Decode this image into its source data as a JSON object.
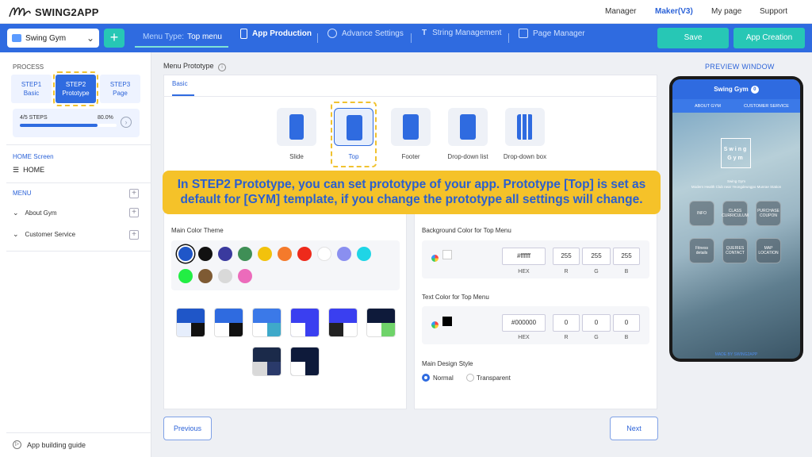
{
  "brand": {
    "name": "SWING2APP"
  },
  "topnav": [
    {
      "label": "Manager",
      "active": false
    },
    {
      "label": "Maker(V3)",
      "active": true
    },
    {
      "label": "My page",
      "active": false
    },
    {
      "label": "Support",
      "active": false
    }
  ],
  "toolbar": {
    "app_name": "Swing Gym",
    "menu_type_label": "Menu Type:",
    "menu_type_value": "Top menu",
    "items": [
      "App Production",
      "Advance Settings",
      "String Management",
      "Page Manager"
    ],
    "save_label": "Save",
    "create_label": "App Creation"
  },
  "sidebar": {
    "process_title": "PROCESS",
    "steps": [
      {
        "line1": "STEP1",
        "line2": "Basic"
      },
      {
        "line1": "STEP2",
        "line2": "Prototype"
      },
      {
        "line1": "STEP3",
        "line2": "Page"
      }
    ],
    "progress_label": "4/5 STEPS",
    "progress_pct": "80.0%",
    "progress_value": 0.8,
    "home_title": "HOME Screen",
    "home_item": "HOME",
    "menu_title": "MENU",
    "menu_items": [
      "About Gym",
      "Customer Service"
    ],
    "guide": "App building guide"
  },
  "main": {
    "title": "Menu Prototype",
    "tab": "Basic",
    "prototypes": [
      "Slide",
      "Top",
      "Footer",
      "Drop-down list",
      "Drop-down box"
    ],
    "banner_line1": "In STEP2 Prototype, you can set prototype of your app. Prototype [Top] is set as",
    "banner_line2": "default for [GYM] template, if you change the prototype all settings will change.",
    "color_theme_label": "Main Color Theme",
    "swatches": [
      "#1f56c8",
      "#111111",
      "#3a3a9e",
      "#3f8f56",
      "#f2c20c",
      "#f47a2b",
      "#ee2a1b",
      "#ffffff",
      "#8a8ff0",
      "#1fd5e6",
      "#22ee44",
      "#7e5a33",
      "#d9d9d9",
      "#ec6bbb"
    ],
    "bg_color_label": "Background Color for Top Menu",
    "bg_hex": "#ffffff",
    "bg_rgb": [
      "255",
      "255",
      "255"
    ],
    "text_color_label": "Text Color for Top Menu",
    "text_hex": "#000000",
    "text_rgb": [
      "0",
      "0",
      "0"
    ],
    "captions": [
      "HEX",
      "R",
      "G",
      "B"
    ],
    "design_style_label": "Main Design Style",
    "design_options": [
      "Normal",
      "Transparent"
    ],
    "prev_label": "Previous",
    "next_label": "Next"
  },
  "preview": {
    "title": "PREVIEW WINDOW",
    "app_name": "Swing Gym",
    "badge": "0",
    "nav": [
      "ABOUT GYM",
      "CUSTOMER SERVICE"
    ],
    "logo_line1": "Swing",
    "logo_line2": "Gym",
    "name": "Swing Gym",
    "subtitle": "Modern Health Club near Yeongdeungpo Munrae Station",
    "buttons": [
      {
        "l1": "INFO",
        "l2": ""
      },
      {
        "l1": "CLASS",
        "l2": "CURRICULUM"
      },
      {
        "l1": "PURCHASE",
        "l2": "COUPON"
      },
      {
        "l1": "Fitness",
        "l2": "details"
      },
      {
        "l1": "QUERIES",
        "l2": "CONTACT"
      },
      {
        "l1": "MAP",
        "l2": "LOCATION"
      }
    ],
    "footer": "MADE BY SWING2APP"
  }
}
